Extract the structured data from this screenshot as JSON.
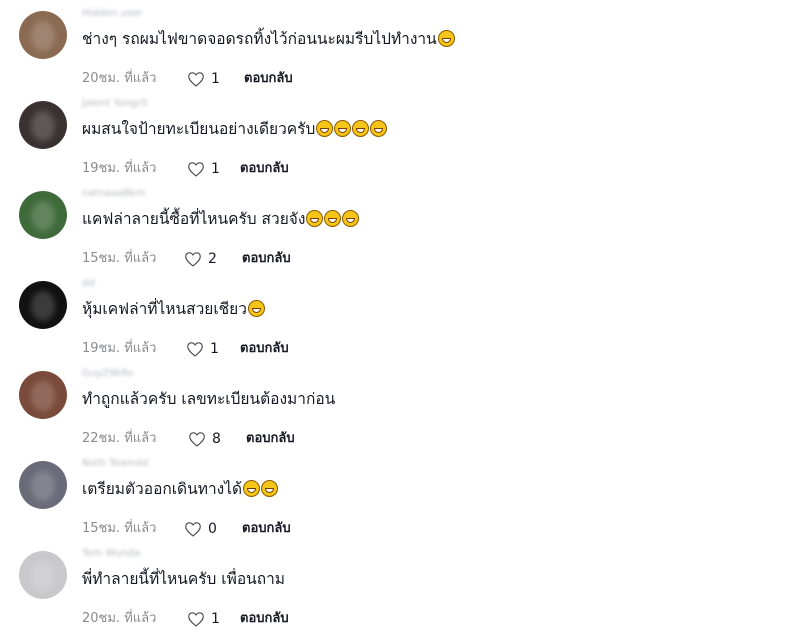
{
  "comments": [
    {
      "username": "Hidden user",
      "text": "ช่างๆ รถผมไฟขาดจอดรถทิ้งไว้ก่อนนะผมรีบไปทำงาน",
      "emojis": [
        "laugh"
      ],
      "time": "20ชม. ที่แล้ว",
      "likes": "1",
      "reply": "ตอบกลับ",
      "avatar": "#8a6a52"
    },
    {
      "username": "Jalent Yongrit",
      "text": "ผมสนใจป้ายทะเบียนอย่างเดียวครับ",
      "emojis": [
        "grin",
        "grin",
        "grin",
        "grin"
      ],
      "time": "19ชม. ที่แล้ว",
      "likes": "1",
      "reply": "ตอบกลับ",
      "avatar": "#3a3230"
    },
    {
      "username": "natnaaaBkm",
      "text": "แคฟล่าลายนี้ซื้อที่ไหนครับ สวยจัง",
      "emojis": [
        "joy",
        "joy",
        "joy"
      ],
      "time": "15ชม. ที่แล้ว",
      "likes": "2",
      "reply": "ตอบกลับ",
      "avatar": "#3f6a3a"
    },
    {
      "username": "dd",
      "text": "หุ้มเคฟล่าที่ไหนสวยเชียว",
      "emojis": [
        "joy"
      ],
      "time": "19ชม. ที่แล้ว",
      "likes": "1",
      "reply": "ตอบกลับ",
      "avatar": "#111111"
    },
    {
      "username": "GuyZ9kRo",
      "text": "ทำถูกแล้วครับ เลขทะเบียนต้องมาก่อน",
      "emojis": [],
      "time": "22ชม. ที่แล้ว",
      "likes": "8",
      "reply": "ตอบกลับ",
      "avatar": "#7a4a3a"
    },
    {
      "username": "Noth Teamdd",
      "text": "เตรียมตัวออกเดินทางได้",
      "emojis": [
        "sweat",
        "sweat"
      ],
      "time": "15ชม. ที่แล้ว",
      "likes": "0",
      "reply": "ตอบกลับ",
      "avatar": "#6a6a78"
    },
    {
      "username": "Tom Wunda",
      "text": "พี่ทำลายนี้ที่ไหนครับ เพื่อนถาม",
      "emojis": [],
      "time": "20ชม. ที่แล้ว",
      "likes": "1",
      "reply": "ตอบกลับ",
      "avatar": "#c9c9cc"
    }
  ]
}
